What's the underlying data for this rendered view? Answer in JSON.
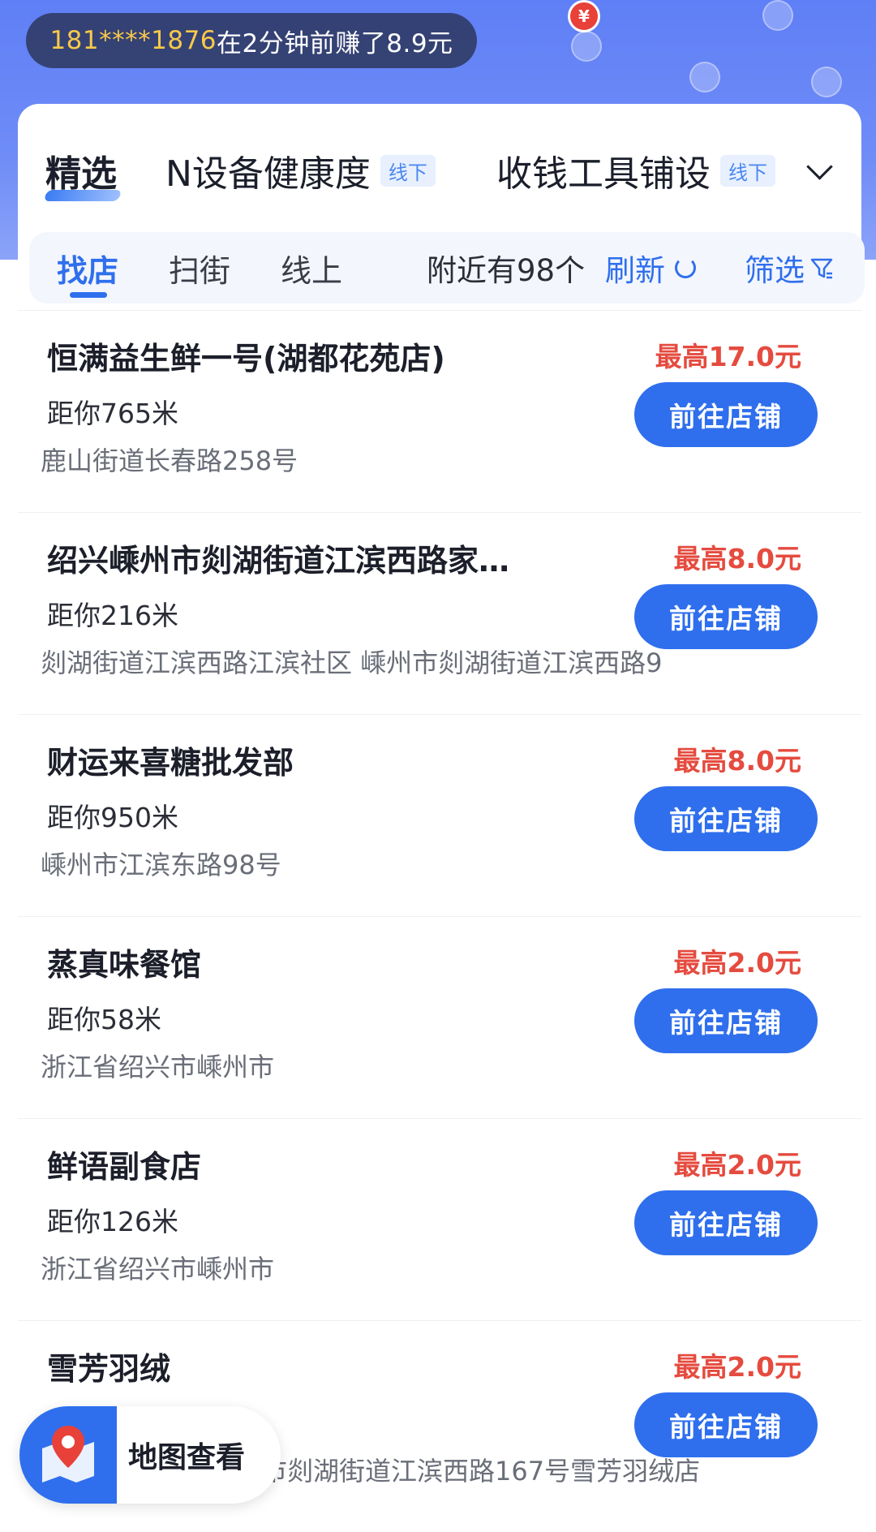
{
  "ticker": {
    "phone": "181****1876",
    "message": "在2分钟前赚了8.9元"
  },
  "topnav": {
    "tab1": "精选",
    "tab2": "N设备健康度",
    "tab2_tag": "线下",
    "tab3": "收钱工具铺设",
    "tab3_tag": "线下"
  },
  "subbar": {
    "sub1": "找店",
    "sub2": "扫街",
    "sub3": "线上",
    "count": "附近有98个",
    "refresh": "刷新",
    "filter": "筛选"
  },
  "stores": [
    {
      "name": "恒满益生鲜一号(湖都花苑店)",
      "distance": "距你765米",
      "address": "鹿山街道长春路258号",
      "reward": "最高17.0元",
      "button": "前往店铺"
    },
    {
      "name": "绍兴嵊州市剡湖街道江滨西路家汇…",
      "distance": "距你216米",
      "address": "剡湖街道江滨西路江滨社区 嵊州市剡湖街道江滨西路9",
      "reward": "最高8.0元",
      "button": "前往店铺"
    },
    {
      "name": "财运来喜糖批发部",
      "distance": "距你950米",
      "address": "嵊州市江滨东路98号",
      "reward": "最高8.0元",
      "button": "前往店铺"
    },
    {
      "name": "蒸真味餐馆",
      "distance": "距你58米",
      "address": "浙江省绍兴市嵊州市",
      "reward": "最高2.0元",
      "button": "前往店铺"
    },
    {
      "name": "鲜语副食店",
      "distance": "距你126米",
      "address": "浙江省绍兴市嵊州市",
      "reward": "最高2.0元",
      "button": "前往店铺"
    },
    {
      "name": "雪芳羽绒",
      "distance": "",
      "address": "市剡湖街道江滨西路167号雪芳羽绒店",
      "reward": "最高2.0元",
      "button": "前往店铺"
    }
  ],
  "map_button": {
    "label": "地图查看"
  },
  "icons": {
    "pin_marker": "yen-pin-icon",
    "map": "map-pin-icon",
    "refresh": "refresh-icon",
    "filter": "filter-icon"
  },
  "colors": {
    "accent": "#2f6fed",
    "reward": "#e54b3f",
    "ticker_phone": "#f7c94a"
  }
}
